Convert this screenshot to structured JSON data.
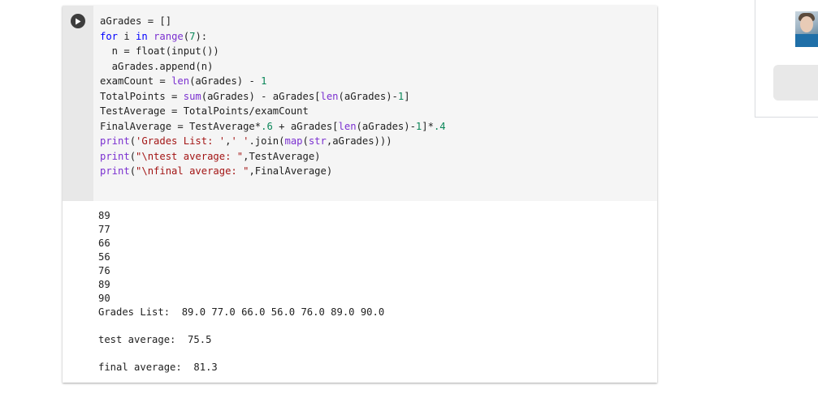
{
  "cell": {
    "code_lines": [
      [
        {
          "t": "aGrades = []",
          "c": ""
        }
      ],
      [
        {
          "t": "for",
          "c": "kw"
        },
        {
          "t": " i ",
          "c": ""
        },
        {
          "t": "in",
          "c": "kw"
        },
        {
          "t": " ",
          "c": ""
        },
        {
          "t": "range",
          "c": "bi"
        },
        {
          "t": "(",
          "c": ""
        },
        {
          "t": "7",
          "c": "num"
        },
        {
          "t": "):",
          "c": ""
        }
      ],
      [
        {
          "t": "  n = float(input())",
          "c": ""
        }
      ],
      [
        {
          "t": "  aGrades.append(n)",
          "c": ""
        }
      ],
      [
        {
          "t": "examCount = ",
          "c": ""
        },
        {
          "t": "len",
          "c": "bi"
        },
        {
          "t": "(aGrades) - ",
          "c": ""
        },
        {
          "t": "1",
          "c": "num"
        }
      ],
      [
        {
          "t": "TotalPoints = ",
          "c": ""
        },
        {
          "t": "sum",
          "c": "bi"
        },
        {
          "t": "(aGrades) - aGrades[",
          "c": ""
        },
        {
          "t": "len",
          "c": "bi"
        },
        {
          "t": "(aGrades)-",
          "c": ""
        },
        {
          "t": "1",
          "c": "num"
        },
        {
          "t": "]",
          "c": ""
        }
      ],
      [
        {
          "t": "TestAverage = TotalPoints/examCount",
          "c": ""
        }
      ],
      [
        {
          "t": "FinalAverage = TestAverage*",
          "c": ""
        },
        {
          "t": ".6",
          "c": "num"
        },
        {
          "t": " + aGrades[",
          "c": ""
        },
        {
          "t": "len",
          "c": "bi"
        },
        {
          "t": "(aGrades)-",
          "c": ""
        },
        {
          "t": "1",
          "c": "num"
        },
        {
          "t": "]*",
          "c": ""
        },
        {
          "t": ".4",
          "c": "num"
        }
      ],
      [
        {
          "t": "print",
          "c": "bi"
        },
        {
          "t": "(",
          "c": ""
        },
        {
          "t": "'Grades List: '",
          "c": "str"
        },
        {
          "t": ",",
          "c": ""
        },
        {
          "t": "' '",
          "c": "str"
        },
        {
          "t": ".join(",
          "c": ""
        },
        {
          "t": "map",
          "c": "bi"
        },
        {
          "t": "(",
          "c": ""
        },
        {
          "t": "str",
          "c": "bi"
        },
        {
          "t": ",aGrades)))",
          "c": ""
        }
      ],
      [
        {
          "t": "print",
          "c": "bi"
        },
        {
          "t": "(",
          "c": ""
        },
        {
          "t": "\"\\ntest average: \"",
          "c": "str"
        },
        {
          "t": ",TestAverage)",
          "c": ""
        }
      ],
      [
        {
          "t": "print",
          "c": "bi"
        },
        {
          "t": "(",
          "c": ""
        },
        {
          "t": "\"\\nfinal average: \"",
          "c": "str"
        },
        {
          "t": ",FinalAverage)",
          "c": ""
        }
      ]
    ],
    "output_lines": [
      "89",
      "77",
      "66",
      "56",
      "76",
      "89",
      "90",
      "Grades List:  89.0 77.0 66.0 56.0 76.0 89.0 90.0",
      "",
      "test average:  75.5",
      "",
      "final average:  81.3"
    ]
  },
  "colors": {
    "keyword": "#0000ff",
    "builtin": "#7b30d0",
    "number": "#098658",
    "string": "#a31515"
  },
  "icons": {
    "run": "play-circle-icon"
  }
}
